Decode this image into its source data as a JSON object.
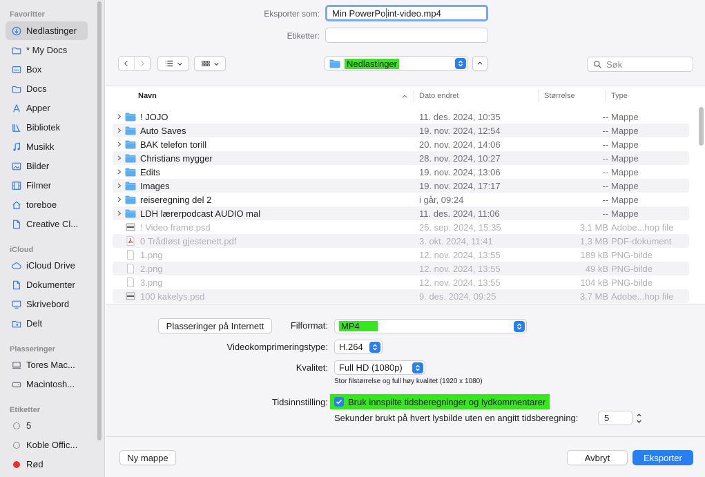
{
  "sidebar": {
    "sections": {
      "favorites": "Favoritter",
      "icloud": "iCloud",
      "locations": "Plasseringer",
      "tags": "Etiketter"
    },
    "favorites": [
      {
        "label": "Nedlastinger",
        "icon": "download-icon"
      },
      {
        "label": "* My Docs",
        "icon": "folder-icon"
      },
      {
        "label": "Box",
        "icon": "box-icon"
      },
      {
        "label": "Docs",
        "icon": "folder-icon"
      },
      {
        "label": "Apper",
        "icon": "apps-icon"
      },
      {
        "label": "Bibliotek",
        "icon": "library-icon"
      },
      {
        "label": "Musikk",
        "icon": "music-icon"
      },
      {
        "label": "Bilder",
        "icon": "photos-icon"
      },
      {
        "label": "Filmer",
        "icon": "movies-icon"
      },
      {
        "label": "toreboe",
        "icon": "home-icon"
      },
      {
        "label": "Creative Cl...",
        "icon": "document-icon"
      }
    ],
    "icloud": [
      {
        "label": "iCloud Drive",
        "icon": "cloud-icon"
      },
      {
        "label": "Dokumenter",
        "icon": "document-icon"
      },
      {
        "label": "Skrivebord",
        "icon": "desktop-icon"
      },
      {
        "label": "Delt",
        "icon": "shared-folder-icon"
      }
    ],
    "locations": [
      {
        "label": "Tores Mac...",
        "icon": "computer-icon"
      },
      {
        "label": "Macintosh...",
        "icon": "disk-icon"
      }
    ],
    "tags": [
      {
        "label": "5",
        "color": "#ffffff"
      },
      {
        "label": "Koble Offic...",
        "color": "#ffffff"
      },
      {
        "label": "Rød",
        "color": "#e5322c"
      }
    ]
  },
  "save": {
    "export_as_label": "Eksporter som:",
    "filename_before_caret": "Min PowerPo",
    "filename_after_caret": "int-video.mp4",
    "tags_label": "Etiketter:",
    "tags_value": ""
  },
  "toolbar": {
    "location": "Nedlastinger",
    "search_placeholder": "Søk"
  },
  "columns": {
    "name": "Navn",
    "date": "Dato endret",
    "size": "Størrelse",
    "type": "Type"
  },
  "files": [
    {
      "name": "! JOJO",
      "date": "11. des. 2024, 10:35",
      "size": "--",
      "type": "Mappe",
      "kind": "folder",
      "enabled": true
    },
    {
      "name": "Auto Saves",
      "date": "19. nov. 2024, 12:54",
      "size": "--",
      "type": "Mappe",
      "kind": "folder",
      "enabled": true
    },
    {
      "name": "BAK telefon torill",
      "date": "20. nov. 2024, 14:06",
      "size": "--",
      "type": "Mappe",
      "kind": "folder",
      "enabled": true
    },
    {
      "name": "Christians mygger",
      "date": "28. nov. 2024, 10:27",
      "size": "--",
      "type": "Mappe",
      "kind": "folder",
      "enabled": true
    },
    {
      "name": "Edits",
      "date": "19. nov. 2024, 13:06",
      "size": "--",
      "type": "Mappe",
      "kind": "folder",
      "enabled": true
    },
    {
      "name": "Images",
      "date": "19. nov. 2024, 17:17",
      "size": "--",
      "type": "Mappe",
      "kind": "folder",
      "enabled": true
    },
    {
      "name": "reiseregning del 2",
      "date": "i går, 09:24",
      "size": "--",
      "type": "Mappe",
      "kind": "folder",
      "enabled": true
    },
    {
      "name": "LDH lærerpodcast AUDIO mal",
      "date": "11. des. 2024, 11:06",
      "size": "--",
      "type": "Mappe",
      "kind": "folder",
      "enabled": true
    },
    {
      "name": "! Video frame.psd",
      "date": "25. sep. 2024, 15:35",
      "size": "3,1 MB",
      "type": "Adobe...hop file",
      "kind": "psd",
      "enabled": false
    },
    {
      "name": "0 Trådløst gjestenett.pdf",
      "date": "3. okt. 2024, 11:41",
      "size": "1,3 MB",
      "type": "PDF-dokument",
      "kind": "pdf",
      "enabled": false
    },
    {
      "name": "1.png",
      "date": "12. nov. 2024, 13:55",
      "size": "189 kB",
      "type": "PNG-bilde",
      "kind": "png",
      "enabled": false
    },
    {
      "name": "2.png",
      "date": "12. nov. 2024, 13:55",
      "size": "49 kB",
      "type": "PNG-bilde",
      "kind": "png",
      "enabled": false
    },
    {
      "name": "3.png",
      "date": "12. nov. 2024, 13:55",
      "size": "104 kB",
      "type": "PNG-bilde",
      "kind": "png",
      "enabled": false
    },
    {
      "name": "100 kakelys.psd",
      "date": "9. des. 2024, 09:25",
      "size": "3,7 MB",
      "type": "Adobe...hop file",
      "kind": "psd",
      "enabled": false
    }
  ],
  "options": {
    "online_locations_button": "Plasseringer på Internett",
    "format_label": "Filformat:",
    "format_value": "MP4",
    "compression_label": "Videokomprimeringstype:",
    "compression_value": "H.264",
    "quality_label": "Kvalitet:",
    "quality_value": "Full HD (1080p)",
    "quality_hint": "Stor filstørrelse og full høy kvalitet (1920 x 1080)",
    "timing_label": "Tidsinnstilling:",
    "timing_checkbox": "Bruk innspilte tidsberegninger og lydkommentarer",
    "timing_checked": true,
    "seconds_label": "Sekunder brukt på hvert lysbilde uten en angitt tidsberegning:",
    "seconds_value": "5"
  },
  "footer": {
    "new_folder": "Ny mappe",
    "cancel": "Avbryt",
    "export": "Eksporter"
  },
  "colors": {
    "accent": "#2a7ff0",
    "highlight": "#35e81b",
    "folder": "#5aaef0"
  }
}
